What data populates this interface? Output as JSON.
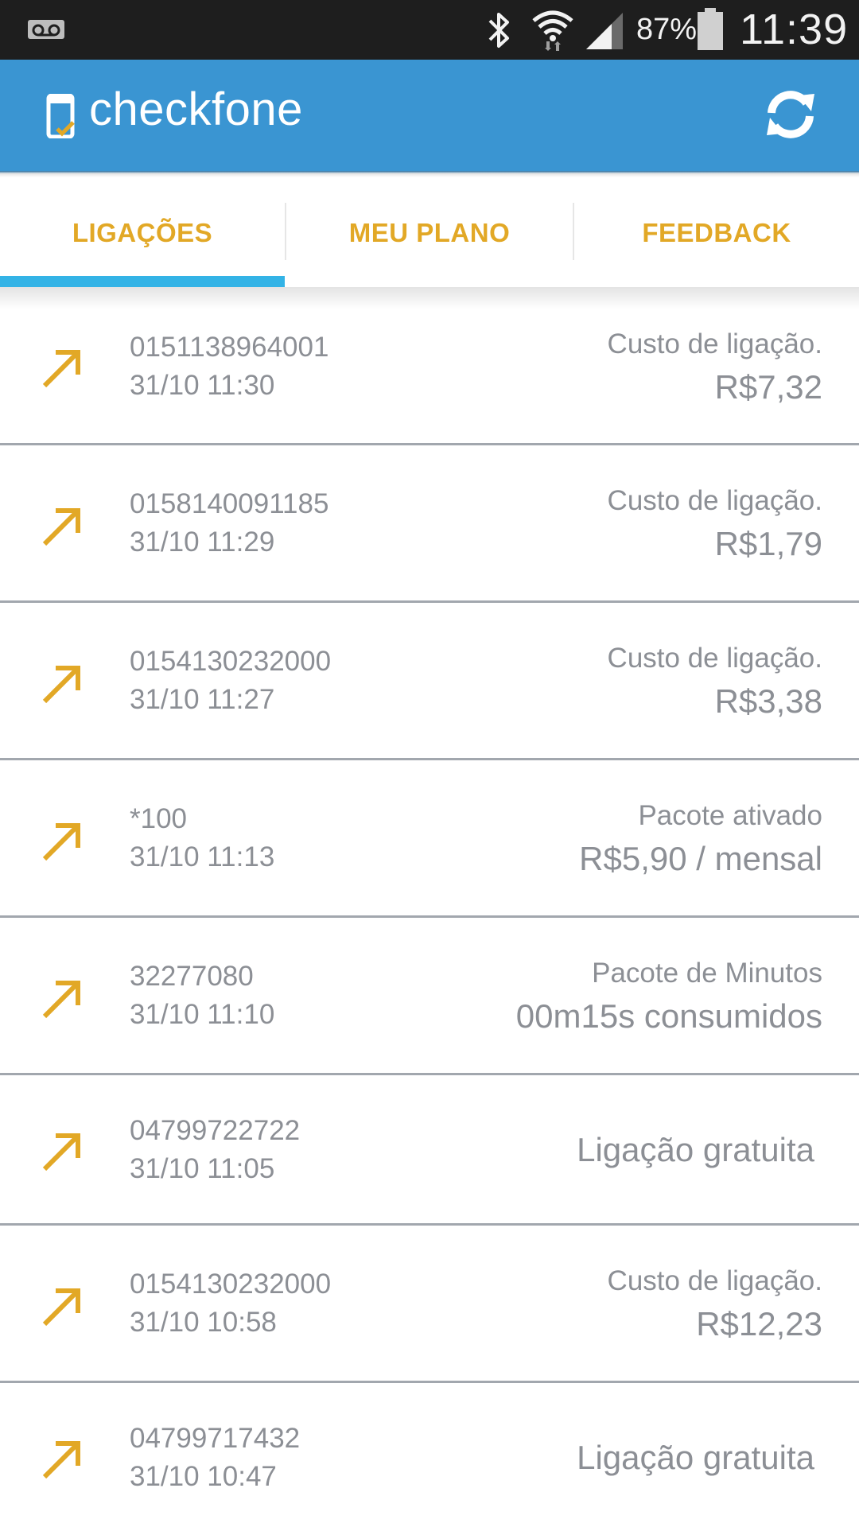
{
  "status_bar": {
    "battery": "87%",
    "time": "11:39",
    "icons": [
      "voicemail-icon",
      "bluetooth-icon",
      "wifi-icon",
      "cell-signal-icon",
      "battery-icon"
    ]
  },
  "app_bar": {
    "title": "checkfone",
    "logo_icon": "phone-check-icon",
    "action_icon": "refresh-icon",
    "color": "#3a95d2"
  },
  "tabs": [
    {
      "label": "LIGAÇÕES",
      "selected": true
    },
    {
      "label": "MEU PLANO",
      "selected": false
    },
    {
      "label": "FEEDBACK",
      "selected": false
    }
  ],
  "colors": {
    "accent": "#e2a826",
    "tab_indicator": "#33b3e6",
    "text_secondary": "#8c8f95"
  },
  "calls": [
    {
      "number": "0151138964001",
      "datetime": "31/10 11:30",
      "label": "Custo de ligação.",
      "value": "R$7,32",
      "icon": "outgoing-call-arrow-icon"
    },
    {
      "number": "0158140091185",
      "datetime": "31/10 11:29",
      "label": "Custo de ligação.",
      "value": "R$1,79",
      "icon": "outgoing-call-arrow-icon"
    },
    {
      "number": "0154130232000",
      "datetime": "31/10 11:27",
      "label": "Custo de ligação.",
      "value": "R$3,38",
      "icon": "outgoing-call-arrow-icon"
    },
    {
      "number": "*100",
      "datetime": "31/10 11:13",
      "label": "Pacote ativado",
      "value": "R$5,90 / mensal",
      "icon": "outgoing-call-arrow-icon"
    },
    {
      "number": "32277080",
      "datetime": "31/10 11:10",
      "label": "Pacote de Minutos",
      "value": "00m15s consumidos",
      "icon": "outgoing-call-arrow-icon"
    },
    {
      "number": "04799722722",
      "datetime": "31/10 11:05",
      "label": "",
      "value": "Ligação gratuita",
      "icon": "outgoing-call-arrow-icon"
    },
    {
      "number": "0154130232000",
      "datetime": "31/10 10:58",
      "label": "Custo de ligação.",
      "value": "R$12,23",
      "icon": "outgoing-call-arrow-icon"
    },
    {
      "number": "04799717432",
      "datetime": "31/10 10:47",
      "label": "",
      "value": "Ligação gratuita",
      "icon": "outgoing-call-arrow-icon"
    }
  ]
}
